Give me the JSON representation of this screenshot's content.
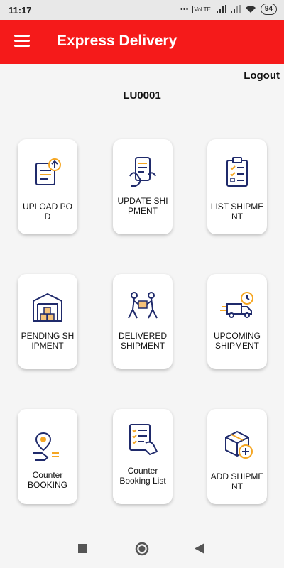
{
  "status": {
    "time": "11:17",
    "signal": "VoLTE",
    "battery": "94"
  },
  "header": {
    "title": "Express Delivery"
  },
  "account": {
    "logout_label": "Logout",
    "user_id": "LU0001"
  },
  "tiles": [
    {
      "label": "UPLOAD POD",
      "icon": "upload-document-icon"
    },
    {
      "label": "UPDATE SHIPMENT",
      "icon": "tablet-hand-icon"
    },
    {
      "label": "LIST SHIPMENT",
      "icon": "clipboard-list-icon"
    },
    {
      "label": "PENDING SHIPMENT",
      "icon": "warehouse-icon"
    },
    {
      "label": "DELIVERED SHIPMENT",
      "icon": "delivery-people-icon"
    },
    {
      "label": "UPCOMING SHIPMENT",
      "icon": "fast-truck-icon"
    },
    {
      "label": "Counter BOOKING",
      "icon": "location-pin-hand-icon"
    },
    {
      "label": "Counter Booking List",
      "icon": "checklist-hand-icon"
    },
    {
      "label": "ADD SHIPMENT",
      "icon": "add-box-icon"
    }
  ],
  "colors": {
    "brand": "#f51a1a",
    "icon_primary": "#1f2a6b",
    "icon_accent": "#f5a623"
  }
}
